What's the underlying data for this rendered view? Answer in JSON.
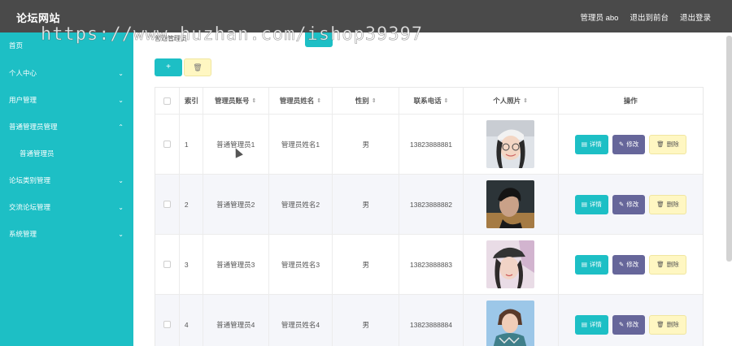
{
  "app": {
    "title": "论坛网站"
  },
  "header": {
    "user_label": "管理员 abo",
    "to_front_label": "退出到前台",
    "logout_label": "退出登录"
  },
  "sidebar": {
    "items": [
      {
        "label": "首页",
        "chevron": ""
      },
      {
        "label": "个人中心",
        "chevron": "⌄"
      },
      {
        "label": "用户管理",
        "chevron": "⌄"
      },
      {
        "label": "普通管理员管理",
        "chevron": "⌃"
      },
      {
        "label": "普通管理员",
        "chevron": ""
      },
      {
        "label": "论坛类别管理",
        "chevron": "⌄"
      },
      {
        "label": "交流论坛管理",
        "chevron": "⌄"
      },
      {
        "label": "系统管理",
        "chevron": "⌄"
      }
    ]
  },
  "breadcrumb": "普通管理员",
  "toolbar": {
    "add_label": "+",
    "delete_label": "🗑"
  },
  "table": {
    "headers": [
      "索引",
      "管理员账号",
      "管理员姓名",
      "性别",
      "联系电话",
      "个人照片",
      "操作"
    ],
    "rows": [
      {
        "index": "1",
        "account": "普通管理员1",
        "name": "管理员姓名1",
        "gender": "男",
        "phone": "13823888881"
      },
      {
        "index": "2",
        "account": "普通管理员2",
        "name": "管理员姓名2",
        "gender": "男",
        "phone": "13823888882"
      },
      {
        "index": "3",
        "account": "普通管理员3",
        "name": "管理员姓名3",
        "gender": "男",
        "phone": "13823888883"
      },
      {
        "index": "4",
        "account": "普通管理员4",
        "name": "管理员姓名4",
        "gender": "男",
        "phone": "13823888884"
      }
    ],
    "actions": {
      "detail": "详情",
      "edit": "修改",
      "delete": "删除"
    }
  },
  "watermark": "https://www.huzhan.com/ishop39397",
  "colors": {
    "accent": "#1dbfc5",
    "topbar": "#4a4a4a",
    "edit": "#66669a",
    "warn": "#fff7c2"
  }
}
